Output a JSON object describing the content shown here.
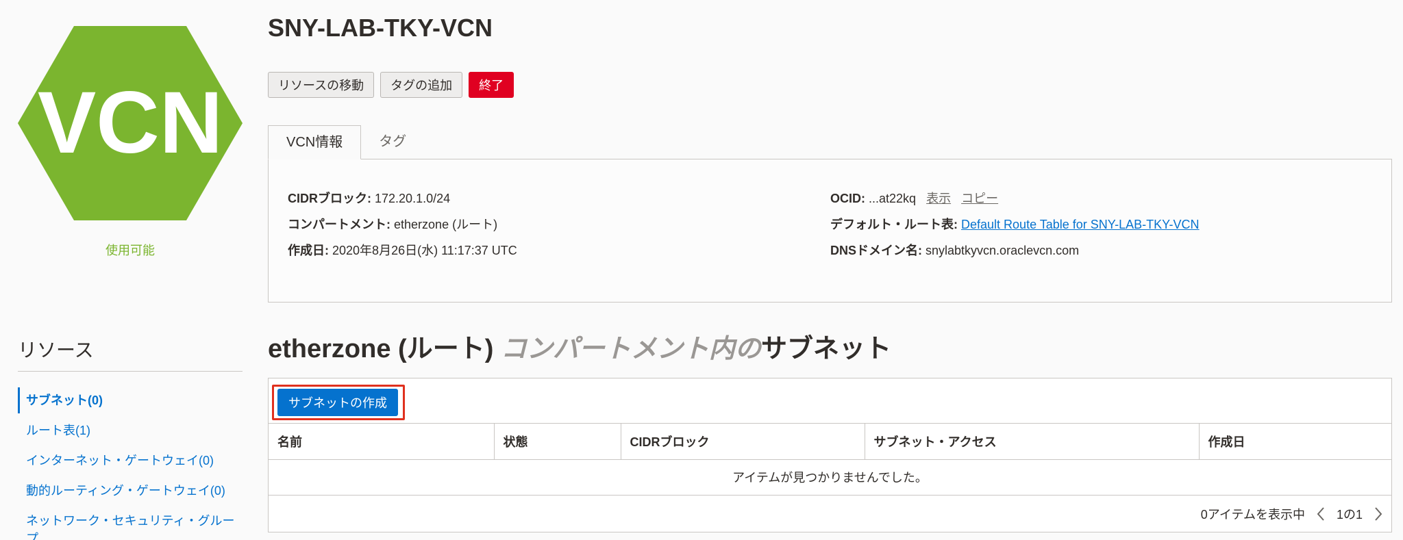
{
  "status": {
    "text": "使用可能",
    "color": "#7bb52f"
  },
  "logo": {
    "text": "VCN",
    "color": "#7bb52f"
  },
  "resources": {
    "title": "リソース",
    "items": [
      {
        "label": "サブネット(0)",
        "active": true
      },
      {
        "label": "ルート表(1)"
      },
      {
        "label": "インターネット・ゲートウェイ(0)"
      },
      {
        "label": "動的ルーティング・ゲートウェイ(0)"
      },
      {
        "label": "ネットワーク・セキュリティ・グループ"
      }
    ]
  },
  "header": {
    "title": "SNY-LAB-TKY-VCN"
  },
  "actions": {
    "move": "リソースの移動",
    "add_tag": "タグの追加",
    "terminate": "終了"
  },
  "tabs": [
    {
      "label": "VCN情報",
      "active": true
    },
    {
      "label": "タグ"
    }
  ],
  "info": {
    "cidr": {
      "label": "CIDRブロック:",
      "value": "172.20.1.0/24"
    },
    "compartment": {
      "label": "コンパートメント:",
      "value": "etherzone (ルート)"
    },
    "created": {
      "label": "作成日:",
      "value": "2020年8月26日(水) 11:17:37 UTC"
    },
    "ocid": {
      "label": "OCID:",
      "value": "...at22kq",
      "show": "表示",
      "copy": "コピー"
    },
    "route_table": {
      "label": "デフォルト・ルート表:",
      "value": "Default Route Table for SNY-LAB-TKY-VCN"
    },
    "dns": {
      "label": "DNSドメイン名:",
      "value": "snylabtkyvcn.oraclevcn.com"
    }
  },
  "subnets": {
    "title_prefix": "etherzone (ルート)",
    "title_italic": "コンパートメント内の",
    "title_suffix": "サブネット",
    "create_button": "サブネットの作成",
    "columns": [
      "名前",
      "状態",
      "CIDRブロック",
      "サブネット・アクセス",
      "作成日"
    ],
    "empty_message": "アイテムが見つかりませんでした。",
    "showing": "0アイテムを表示中",
    "page": "1の1"
  },
  "colors": {
    "primary": "#0572ce",
    "danger": "#e00021",
    "highlight": "#e0301e"
  }
}
